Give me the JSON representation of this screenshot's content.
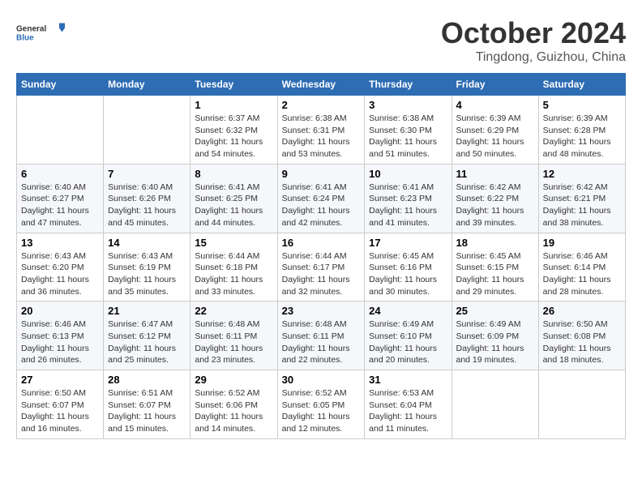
{
  "header": {
    "logo": {
      "general": "General",
      "blue": "Blue"
    },
    "title": "October 2024",
    "location": "Tingdong, Guizhou, China"
  },
  "calendar": {
    "days_of_week": [
      "Sunday",
      "Monday",
      "Tuesday",
      "Wednesday",
      "Thursday",
      "Friday",
      "Saturday"
    ],
    "weeks": [
      [
        {
          "day": "",
          "info": ""
        },
        {
          "day": "",
          "info": ""
        },
        {
          "day": "1",
          "info": "Sunrise: 6:37 AM\nSunset: 6:32 PM\nDaylight: 11 hours and 54 minutes."
        },
        {
          "day": "2",
          "info": "Sunrise: 6:38 AM\nSunset: 6:31 PM\nDaylight: 11 hours and 53 minutes."
        },
        {
          "day": "3",
          "info": "Sunrise: 6:38 AM\nSunset: 6:30 PM\nDaylight: 11 hours and 51 minutes."
        },
        {
          "day": "4",
          "info": "Sunrise: 6:39 AM\nSunset: 6:29 PM\nDaylight: 11 hours and 50 minutes."
        },
        {
          "day": "5",
          "info": "Sunrise: 6:39 AM\nSunset: 6:28 PM\nDaylight: 11 hours and 48 minutes."
        }
      ],
      [
        {
          "day": "6",
          "info": "Sunrise: 6:40 AM\nSunset: 6:27 PM\nDaylight: 11 hours and 47 minutes."
        },
        {
          "day": "7",
          "info": "Sunrise: 6:40 AM\nSunset: 6:26 PM\nDaylight: 11 hours and 45 minutes."
        },
        {
          "day": "8",
          "info": "Sunrise: 6:41 AM\nSunset: 6:25 PM\nDaylight: 11 hours and 44 minutes."
        },
        {
          "day": "9",
          "info": "Sunrise: 6:41 AM\nSunset: 6:24 PM\nDaylight: 11 hours and 42 minutes."
        },
        {
          "day": "10",
          "info": "Sunrise: 6:41 AM\nSunset: 6:23 PM\nDaylight: 11 hours and 41 minutes."
        },
        {
          "day": "11",
          "info": "Sunrise: 6:42 AM\nSunset: 6:22 PM\nDaylight: 11 hours and 39 minutes."
        },
        {
          "day": "12",
          "info": "Sunrise: 6:42 AM\nSunset: 6:21 PM\nDaylight: 11 hours and 38 minutes."
        }
      ],
      [
        {
          "day": "13",
          "info": "Sunrise: 6:43 AM\nSunset: 6:20 PM\nDaylight: 11 hours and 36 minutes."
        },
        {
          "day": "14",
          "info": "Sunrise: 6:43 AM\nSunset: 6:19 PM\nDaylight: 11 hours and 35 minutes."
        },
        {
          "day": "15",
          "info": "Sunrise: 6:44 AM\nSunset: 6:18 PM\nDaylight: 11 hours and 33 minutes."
        },
        {
          "day": "16",
          "info": "Sunrise: 6:44 AM\nSunset: 6:17 PM\nDaylight: 11 hours and 32 minutes."
        },
        {
          "day": "17",
          "info": "Sunrise: 6:45 AM\nSunset: 6:16 PM\nDaylight: 11 hours and 30 minutes."
        },
        {
          "day": "18",
          "info": "Sunrise: 6:45 AM\nSunset: 6:15 PM\nDaylight: 11 hours and 29 minutes."
        },
        {
          "day": "19",
          "info": "Sunrise: 6:46 AM\nSunset: 6:14 PM\nDaylight: 11 hours and 28 minutes."
        }
      ],
      [
        {
          "day": "20",
          "info": "Sunrise: 6:46 AM\nSunset: 6:13 PM\nDaylight: 11 hours and 26 minutes."
        },
        {
          "day": "21",
          "info": "Sunrise: 6:47 AM\nSunset: 6:12 PM\nDaylight: 11 hours and 25 minutes."
        },
        {
          "day": "22",
          "info": "Sunrise: 6:48 AM\nSunset: 6:11 PM\nDaylight: 11 hours and 23 minutes."
        },
        {
          "day": "23",
          "info": "Sunrise: 6:48 AM\nSunset: 6:11 PM\nDaylight: 11 hours and 22 minutes."
        },
        {
          "day": "24",
          "info": "Sunrise: 6:49 AM\nSunset: 6:10 PM\nDaylight: 11 hours and 20 minutes."
        },
        {
          "day": "25",
          "info": "Sunrise: 6:49 AM\nSunset: 6:09 PM\nDaylight: 11 hours and 19 minutes."
        },
        {
          "day": "26",
          "info": "Sunrise: 6:50 AM\nSunset: 6:08 PM\nDaylight: 11 hours and 18 minutes."
        }
      ],
      [
        {
          "day": "27",
          "info": "Sunrise: 6:50 AM\nSunset: 6:07 PM\nDaylight: 11 hours and 16 minutes."
        },
        {
          "day": "28",
          "info": "Sunrise: 6:51 AM\nSunset: 6:07 PM\nDaylight: 11 hours and 15 minutes."
        },
        {
          "day": "29",
          "info": "Sunrise: 6:52 AM\nSunset: 6:06 PM\nDaylight: 11 hours and 14 minutes."
        },
        {
          "day": "30",
          "info": "Sunrise: 6:52 AM\nSunset: 6:05 PM\nDaylight: 11 hours and 12 minutes."
        },
        {
          "day": "31",
          "info": "Sunrise: 6:53 AM\nSunset: 6:04 PM\nDaylight: 11 hours and 11 minutes."
        },
        {
          "day": "",
          "info": ""
        },
        {
          "day": "",
          "info": ""
        }
      ]
    ]
  }
}
